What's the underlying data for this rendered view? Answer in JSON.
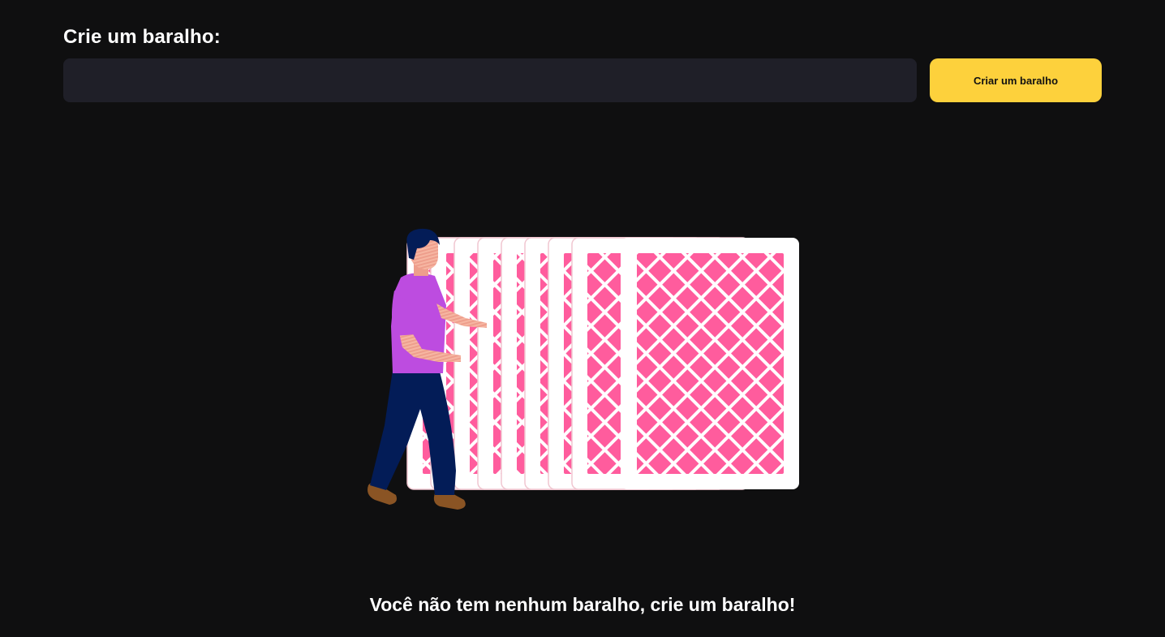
{
  "create_section": {
    "label": "Crie um baralho:",
    "input_value": "",
    "input_placeholder": "",
    "button_label": "Criar um baralho"
  },
  "empty_state": {
    "illustration_icon": "person-with-playing-cards-illustration",
    "message": "Você não tem nenhum baralho, crie um baralho!"
  },
  "colors": {
    "background": "#0f0f10",
    "input_background": "#1f1f28",
    "accent_button": "#fdd13c",
    "card_pattern": "#ff5c9d",
    "text": "#ffffff"
  }
}
